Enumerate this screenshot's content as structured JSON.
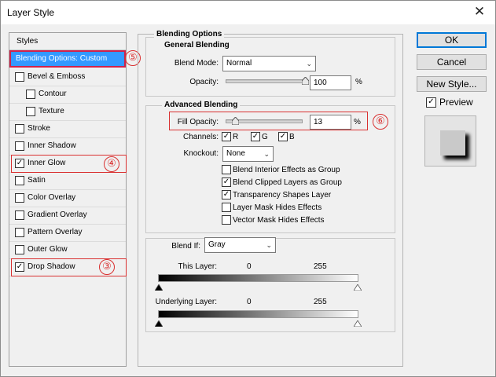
{
  "window": {
    "title": "Layer Style",
    "close_glyph": "✕"
  },
  "styles_panel": {
    "header": "Styles",
    "items": [
      {
        "label": "Blending Options: Custom",
        "checkbox": false,
        "checked": false,
        "selected": true
      },
      {
        "label": "Bevel & Emboss",
        "checkbox": true,
        "checked": false
      },
      {
        "label": "Contour",
        "checkbox": true,
        "checked": false,
        "indent": true
      },
      {
        "label": "Texture",
        "checkbox": true,
        "checked": false,
        "indent": true
      },
      {
        "label": "Stroke",
        "checkbox": true,
        "checked": false
      },
      {
        "label": "Inner Shadow",
        "checkbox": true,
        "checked": false
      },
      {
        "label": "Inner Glow",
        "checkbox": true,
        "checked": true
      },
      {
        "label": "Satin",
        "checkbox": true,
        "checked": false
      },
      {
        "label": "Color Overlay",
        "checkbox": true,
        "checked": false
      },
      {
        "label": "Gradient Overlay",
        "checkbox": true,
        "checked": false
      },
      {
        "label": "Pattern Overlay",
        "checkbox": true,
        "checked": false
      },
      {
        "label": "Outer Glow",
        "checkbox": true,
        "checked": false
      },
      {
        "label": "Drop Shadow",
        "checkbox": true,
        "checked": true
      }
    ]
  },
  "annotations": {
    "n5": "⑤",
    "n4": "④",
    "n3": "③",
    "n6": "⑥",
    "color": "#d93030"
  },
  "blending_options": {
    "title": "Blending Options",
    "general": {
      "title": "General Blending",
      "blend_mode_label": "Blend Mode:",
      "blend_mode_value": "Normal",
      "opacity_label": "Opacity:",
      "opacity_value": "100",
      "opacity_unit": "%",
      "opacity_level": 1.0
    },
    "advanced": {
      "title": "Advanced Blending",
      "fill_opacity_label": "Fill Opacity:",
      "fill_opacity_value": "13",
      "fill_opacity_unit": "%",
      "fill_opacity_level": 0.13,
      "channels_label": "Channels:",
      "channels": [
        {
          "label": "R",
          "checked": true
        },
        {
          "label": "G",
          "checked": true
        },
        {
          "label": "B",
          "checked": true
        }
      ],
      "knockout_label": "Knockout:",
      "knockout_value": "None",
      "options": [
        {
          "label": "Blend Interior Effects as Group",
          "checked": false
        },
        {
          "label": "Blend Clipped Layers as Group",
          "checked": true
        },
        {
          "label": "Transparency Shapes Layer",
          "checked": true
        },
        {
          "label": "Layer Mask Hides Effects",
          "checked": false
        },
        {
          "label": "Vector Mask Hides Effects",
          "checked": false
        }
      ]
    },
    "blend_if": {
      "label": "Blend If:",
      "value": "Gray",
      "this_layer_label": "This Layer:",
      "this_layer_min": "0",
      "this_layer_max": "255",
      "underlying_label": "Underlying Layer:",
      "underlying_min": "0",
      "underlying_max": "255"
    }
  },
  "buttons": {
    "ok": "OK",
    "cancel": "Cancel",
    "new_style": "New Style...",
    "preview_label": "Preview",
    "preview_checked": true
  },
  "check_glyph": "✓",
  "dropdown_glyph": "⌄",
  "colors": {
    "selection": "#3399ff",
    "default_button_border": "#0078d7",
    "annotation": "#d93030"
  }
}
